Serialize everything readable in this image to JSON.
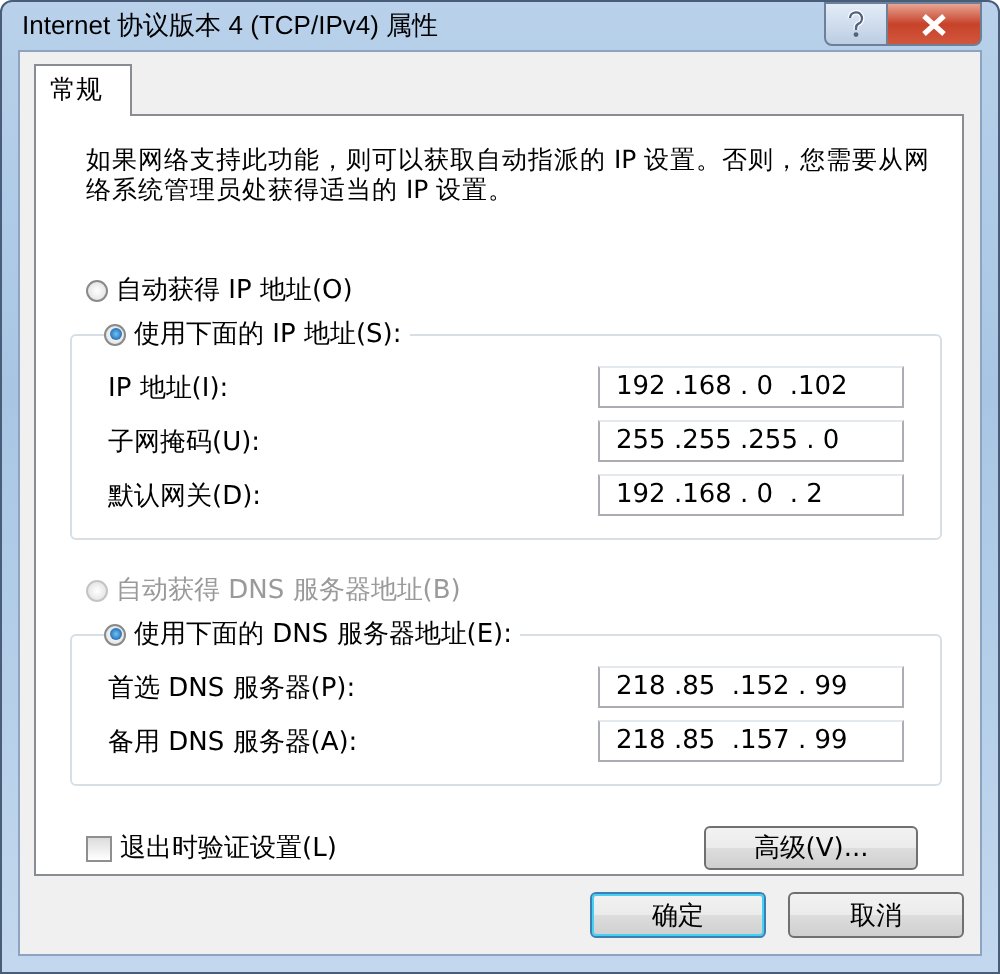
{
  "window": {
    "title": "Internet 协议版本 4 (TCP/IPv4) 属性"
  },
  "tabs": [
    {
      "label": "常规",
      "selected": true
    }
  ],
  "description": "如果网络支持此功能，则可以获取自动指派的 IP 设置。否则，您需要从网络系统管理员处获得适当的 IP 设置。",
  "ip": {
    "options": [
      {
        "label": "自动获得 IP 地址(O)",
        "selected": false,
        "disabled": false
      },
      {
        "label": "使用下面的 IP 地址(S):",
        "selected": true,
        "disabled": false
      }
    ],
    "fields": [
      {
        "label": "IP 地址(I):",
        "value": "192 .168 . 0  .102"
      },
      {
        "label": "子网掩码(U):",
        "value": "255 .255 .255 . 0"
      },
      {
        "label": "默认网关(D):",
        "value": "192 .168 . 0  . 2"
      }
    ]
  },
  "dns": {
    "options": [
      {
        "label": "自动获得 DNS 服务器地址(B)",
        "selected": false,
        "disabled": true
      },
      {
        "label": "使用下面的 DNS 服务器地址(E):",
        "selected": true,
        "disabled": false
      }
    ],
    "fields": [
      {
        "label": "首选 DNS 服务器(P):",
        "value": "218 .85  .152 . 99"
      },
      {
        "label": "备用 DNS 服务器(A):",
        "value": "218 .85  .157 . 99"
      }
    ]
  },
  "validate_on_exit": {
    "label": "退出时验证设置(L)",
    "checked": false
  },
  "advanced_button": "高级(V)...",
  "buttons": [
    {
      "label": "确定",
      "kind": "default"
    },
    {
      "label": "取消",
      "kind": "normal"
    }
  ]
}
